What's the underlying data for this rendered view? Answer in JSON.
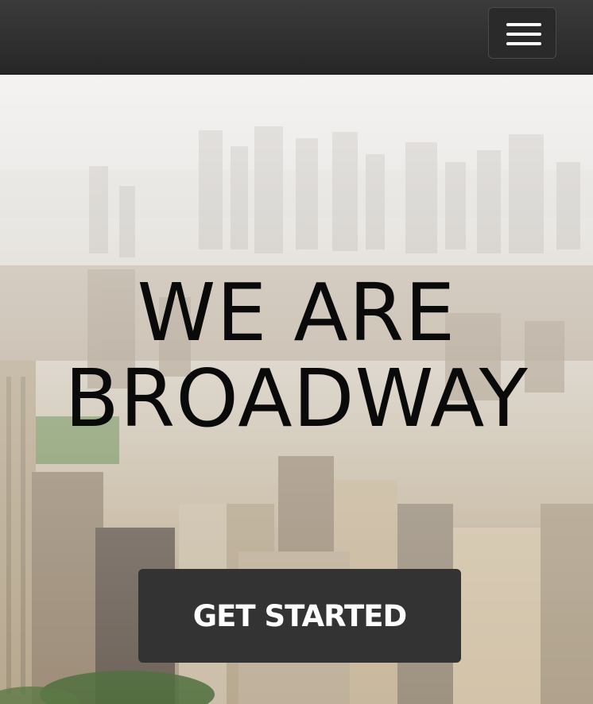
{
  "navbar": {
    "menu_icon": "hamburger-icon",
    "background": "#2e2e2e"
  },
  "hero": {
    "title_line1": "WE ARE",
    "title_line2": "BROADWAY",
    "cta_label": "GET STARTED",
    "cta_color": "#333333",
    "background_image": "aerial-city-skyline"
  }
}
